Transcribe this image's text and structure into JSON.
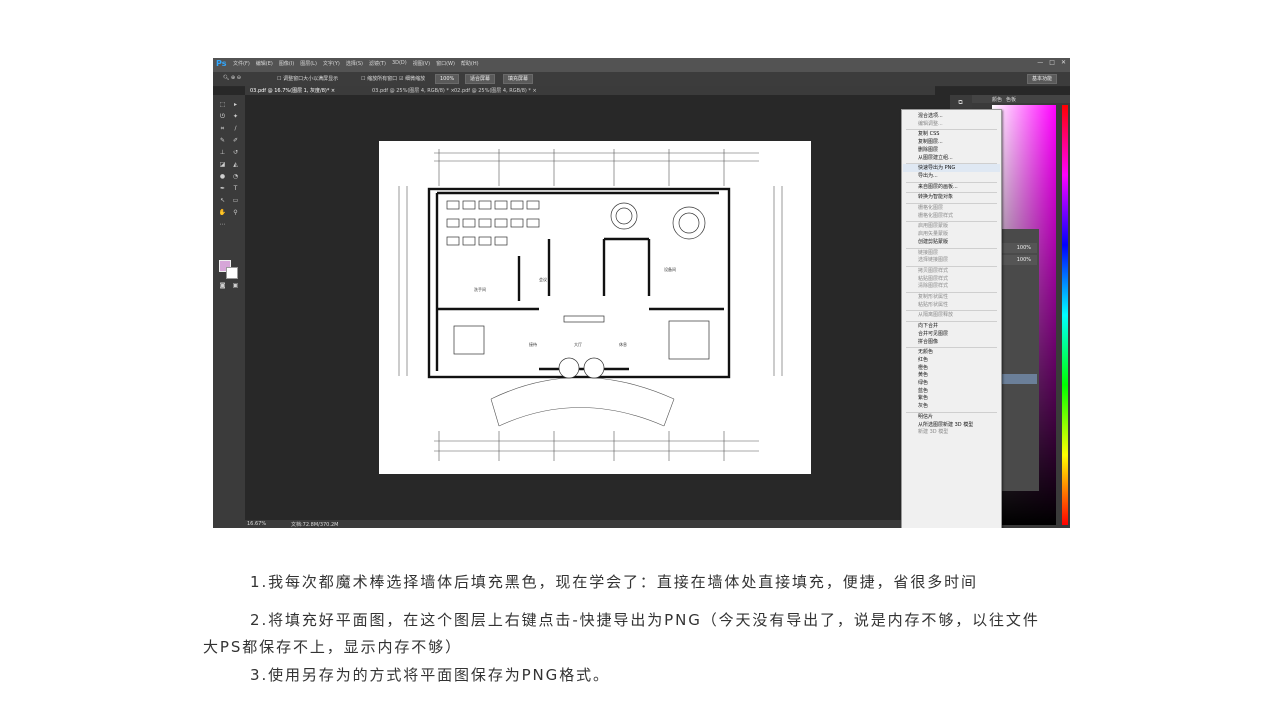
{
  "app": {
    "logo": "Ps",
    "menu": [
      "文件(F)",
      "编辑(E)",
      "图像(I)",
      "图层(L)",
      "文字(Y)",
      "选择(S)",
      "滤镜(T)",
      "3D(D)",
      "视图(V)",
      "窗口(W)",
      "帮助(H)"
    ],
    "window_controls": [
      "—",
      "□",
      "✕"
    ]
  },
  "options_bar": {
    "resize_windows": "调整窗口大小以满屏显示",
    "zoom_all": "缩放所有窗口",
    "scrubby_zoom": "细微缩放",
    "zoom_100": "100%",
    "fit_screen": "适合屏幕",
    "fill_screen": "填充屏幕",
    "workspace": "基本功能"
  },
  "document_tabs": [
    "03.pdf @ 16.7%(图层 1, 灰度/8)* ×",
    "03.pdf @ 25%(图层 4, RGB/8) * ×",
    "02.pdf @ 25%(图层 4, RGB/8) * ×"
  ],
  "status": {
    "zoom": "16.67%",
    "doc": "文档:72.8M/370.2M"
  },
  "color_panel": {
    "tabs": [
      "颜色",
      "色板"
    ]
  },
  "layers_panel": {
    "opacity_1": "100%",
    "opacity_2": "100%"
  },
  "context_menu": {
    "items": [
      {
        "label": "混合选项...",
        "enabled": true
      },
      {
        "label": "编辑调整...",
        "enabled": false
      },
      {
        "sep": true
      },
      {
        "label": "复制 CSS",
        "enabled": true
      },
      {
        "label": "复制图层...",
        "enabled": true
      },
      {
        "label": "删除图层",
        "enabled": true
      },
      {
        "label": "从图层建立组...",
        "enabled": true
      },
      {
        "sep": true
      },
      {
        "label": "快速导出为 PNG",
        "enabled": true,
        "highlight": true
      },
      {
        "label": "导出为...",
        "enabled": true
      },
      {
        "sep": true
      },
      {
        "label": "来自图层的画板...",
        "enabled": true
      },
      {
        "sep": true
      },
      {
        "label": "转换为智能对象",
        "enabled": true
      },
      {
        "sep": true
      },
      {
        "label": "栅格化图层",
        "enabled": false
      },
      {
        "label": "栅格化图层样式",
        "enabled": false
      },
      {
        "sep": true
      },
      {
        "label": "启用图层蒙版",
        "enabled": false
      },
      {
        "label": "启用矢量蒙版",
        "enabled": false
      },
      {
        "label": "创建剪贴蒙版",
        "enabled": true
      },
      {
        "sep": true
      },
      {
        "label": "链接图层",
        "enabled": false
      },
      {
        "label": "选择链接图层",
        "enabled": false
      },
      {
        "sep": true
      },
      {
        "label": "拷贝图层样式",
        "enabled": false
      },
      {
        "label": "粘贴图层样式",
        "enabled": false
      },
      {
        "label": "清除图层样式",
        "enabled": false
      },
      {
        "sep": true
      },
      {
        "label": "复制形状属性",
        "enabled": false
      },
      {
        "label": "粘贴形状属性",
        "enabled": false
      },
      {
        "sep": true
      },
      {
        "label": "从隔离图层释放",
        "enabled": false
      },
      {
        "sep": true
      },
      {
        "label": "向下合并",
        "enabled": true
      },
      {
        "label": "合并可见图层",
        "enabled": true
      },
      {
        "label": "拼合图像",
        "enabled": true
      },
      {
        "sep": true
      },
      {
        "label": "无颜色",
        "enabled": true
      },
      {
        "label": "红色",
        "enabled": true
      },
      {
        "label": "橙色",
        "enabled": true
      },
      {
        "label": "黄色",
        "enabled": true
      },
      {
        "label": "绿色",
        "enabled": true
      },
      {
        "label": "蓝色",
        "enabled": true
      },
      {
        "label": "紫色",
        "enabled": true
      },
      {
        "label": "灰色",
        "enabled": true
      },
      {
        "sep": true
      },
      {
        "label": "明信片",
        "enabled": true
      },
      {
        "label": "从所选图层新建 3D 模型",
        "enabled": true
      },
      {
        "label": "新建 3D 模型",
        "enabled": false
      }
    ]
  },
  "floor_plan": {
    "room_labels": [
      "会议",
      "大厅",
      "接待",
      "休息",
      "洗手间",
      "设备间"
    ]
  },
  "article": {
    "p1": "1.我每次都魔术棒选择墙体后填充黑色，现在学会了：直接在墙体处直接填充，便捷，省很多时间",
    "p2a": "2.将填充好平面图，在这个图层上右键点击-快捷导出为PNG（今天没有导出了，说是内存不够，以往文件",
    "p2b": "大PS都保存不上，显示内存不够）",
    "p3": "3.使用另存为的方式将平面图保存为PNG格式。"
  }
}
